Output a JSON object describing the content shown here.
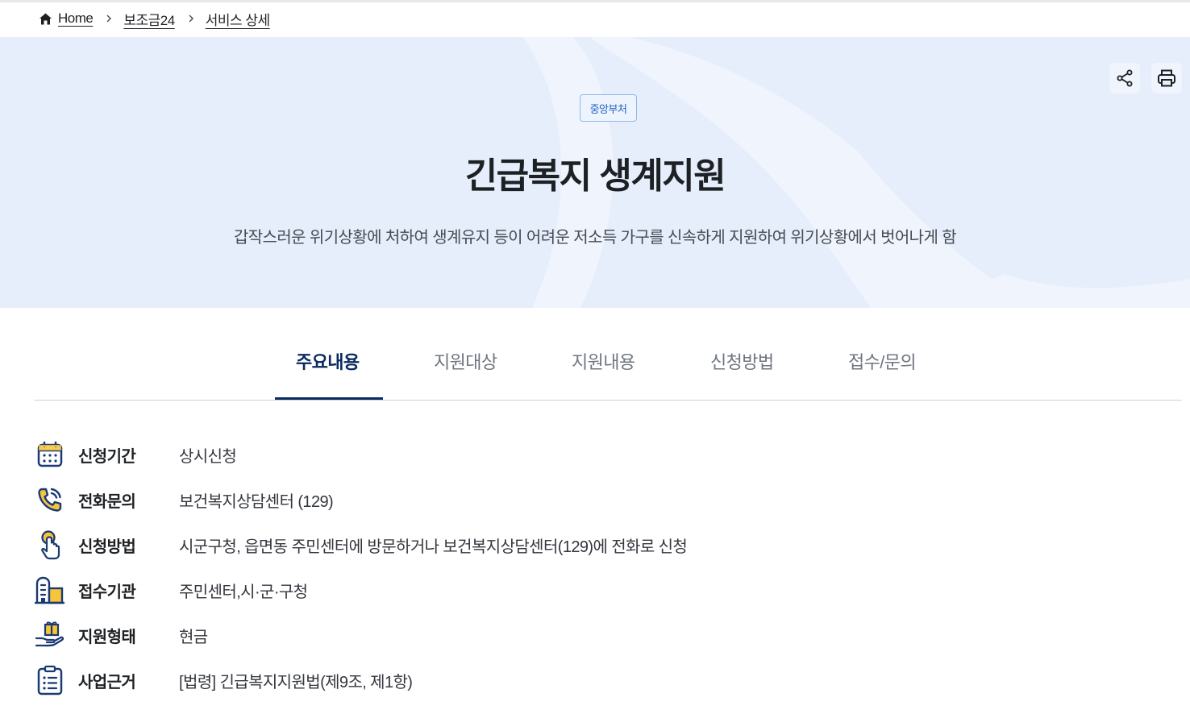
{
  "breadcrumb": {
    "items": [
      "Home",
      "보조금24",
      "서비스 상세"
    ]
  },
  "hero": {
    "badge": "중앙부처",
    "title": "긴급복지 생계지원",
    "description": "갑작스러운 위기상황에 처하여 생계유지 등이 어려운 저소득 가구를 신속하게 지원하여 위기상황에서 벗어나게 함",
    "actions": [
      "share-icon",
      "print-icon"
    ]
  },
  "tabs": [
    {
      "label": "주요내용",
      "active": true
    },
    {
      "label": "지원대상",
      "active": false
    },
    {
      "label": "지원내용",
      "active": false
    },
    {
      "label": "신청방법",
      "active": false
    },
    {
      "label": "접수/문의",
      "active": false
    }
  ],
  "info": [
    {
      "icon": "calendar-icon",
      "label": "신청기간",
      "value": "상시신청"
    },
    {
      "icon": "phone-icon",
      "label": "전화문의",
      "value": "보건복지상담센터 (129)"
    },
    {
      "icon": "hand-pointer-icon",
      "label": "신청방법",
      "value": "시군구청, 읍면동 주민센터에 방문하거나 보건복지상담센터(129)에 전화로 신청"
    },
    {
      "icon": "building-icon",
      "label": "접수기관",
      "value": "주민센터,시·군·구청"
    },
    {
      "icon": "gift-hand-icon",
      "label": "지원형태",
      "value": "현금"
    },
    {
      "icon": "clipboard-list-icon",
      "label": "사업근거",
      "value": "[법령] 긴급복지지원법(제9조, 제1항)"
    }
  ],
  "colors": {
    "hero_bg": "#e6eefc",
    "primary_navy": "#0b2a62",
    "icon_navy": "#1b3a73",
    "icon_accent": "#f7c53b",
    "badge_text": "#1d63c2"
  }
}
